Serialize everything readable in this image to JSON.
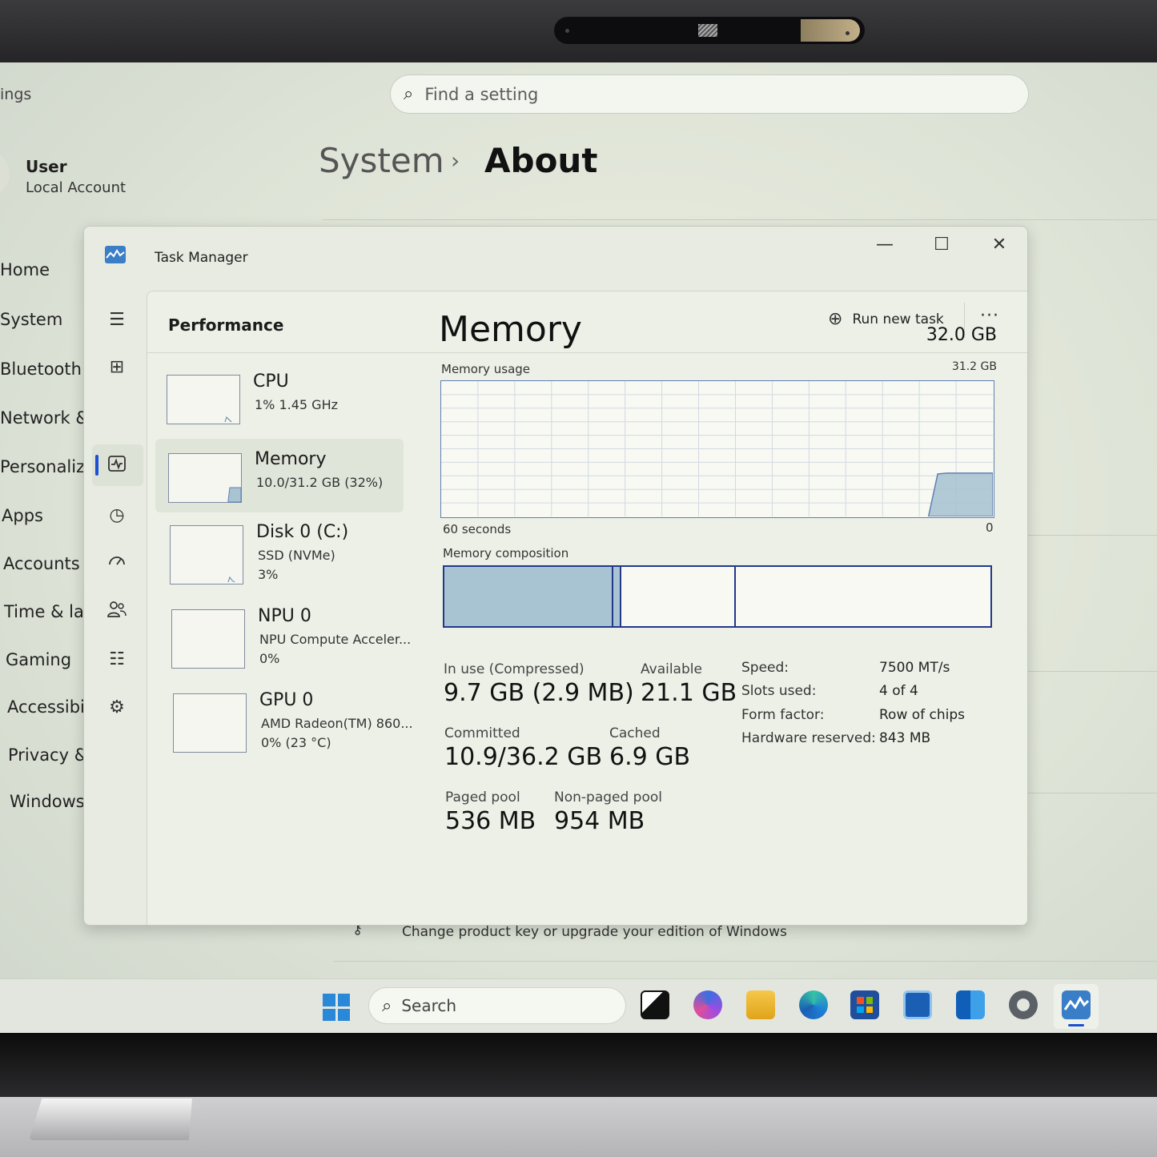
{
  "settings": {
    "app_title": "ings",
    "search_placeholder": "Find a setting",
    "user_name": "User",
    "user_type": "Local Account",
    "breadcrumb": [
      "System",
      "About"
    ],
    "breadcrumb_sep": "›",
    "nav": [
      "Home",
      "System",
      "Bluetooth &",
      "Network &",
      "Personalizat",
      "Apps",
      "Accounts",
      "Time & lang",
      "Gaming",
      "Accessibility",
      "Privacy & se",
      "Windows U"
    ],
    "product_key_text": "Change product key or upgrade your edition of Windows"
  },
  "task_manager": {
    "title": "Task Manager",
    "section": "Performance",
    "run_new_task": "Run new task",
    "more": "···",
    "window_controls": {
      "minimize": "—",
      "maximize": "☐",
      "close": "✕"
    },
    "devices": [
      {
        "name": "CPU",
        "sub": "1%  1.45 GHz",
        "sub2": ""
      },
      {
        "name": "Memory",
        "sub": "10.0/31.2 GB (32%)",
        "sub2": ""
      },
      {
        "name": "Disk 0 (C:)",
        "sub": "SSD (NVMe)",
        "sub2": "3%"
      },
      {
        "name": "NPU 0",
        "sub": "NPU Compute Acceler...",
        "sub2": "0%"
      },
      {
        "name": "GPU 0",
        "sub": "AMD Radeon(TM) 860...",
        "sub2": "0% (23 °C)"
      }
    ],
    "memory": {
      "title": "Memory",
      "total": "32.0 GB",
      "usage_label": "Memory usage",
      "usage_max": "31.2 GB",
      "time_label": "60 seconds",
      "time_zero": "0",
      "composition_label": "Memory composition",
      "composition_fractions": {
        "in_use": 0.31,
        "modified": 0.014,
        "standby": 0.21
      },
      "stats": {
        "in_use_label": "In use (Compressed)",
        "in_use_value": "9.7 GB (2.9 MB)",
        "available_label": "Available",
        "available_value": "21.1 GB",
        "committed_label": "Committed",
        "committed_value": "10.9/36.2 GB",
        "cached_label": "Cached",
        "cached_value": "6.9 GB",
        "paged_label": "Paged pool",
        "paged_value": "536 MB",
        "nonpaged_label": "Non-paged pool",
        "nonpaged_value": "954 MB"
      },
      "specs": [
        {
          "k": "Speed:",
          "v": "7500 MT/s"
        },
        {
          "k": "Slots used:",
          "v": "4 of 4"
        },
        {
          "k": "Form factor:",
          "v": "Row of chips"
        },
        {
          "k": "Hardware reserved:",
          "v": "843 MB"
        }
      ]
    }
  },
  "taskbar": {
    "search_placeholder": "Search",
    "apps": [
      "task-view",
      "copilot",
      "file-explorer",
      "edge",
      "microsoft-store",
      "dev-app",
      "outlook",
      "settings",
      "task-manager"
    ]
  },
  "chart_data": {
    "type": "area",
    "title": "Memory usage",
    "xlabel": "60 seconds",
    "ylabel": "",
    "x_range": [
      60,
      0
    ],
    "ylim": [
      0,
      31.2
    ],
    "series": [
      {
        "values": [
          0,
          0,
          0,
          0,
          0,
          0,
          0,
          0,
          0,
          0,
          0,
          0,
          0,
          0,
          0,
          0,
          0,
          0,
          0,
          0,
          0,
          0,
          0,
          0,
          0,
          0,
          0,
          0,
          0,
          0,
          0,
          0,
          0,
          0,
          0,
          0,
          0,
          0,
          0,
          0,
          0,
          0,
          0,
          0,
          0,
          0,
          0,
          0,
          0,
          0,
          0,
          0,
          0,
          0,
          9.8,
          10.0,
          10.0,
          10.0,
          10.0,
          10.0,
          10.0
        ]
      }
    ],
    "grid": true
  }
}
